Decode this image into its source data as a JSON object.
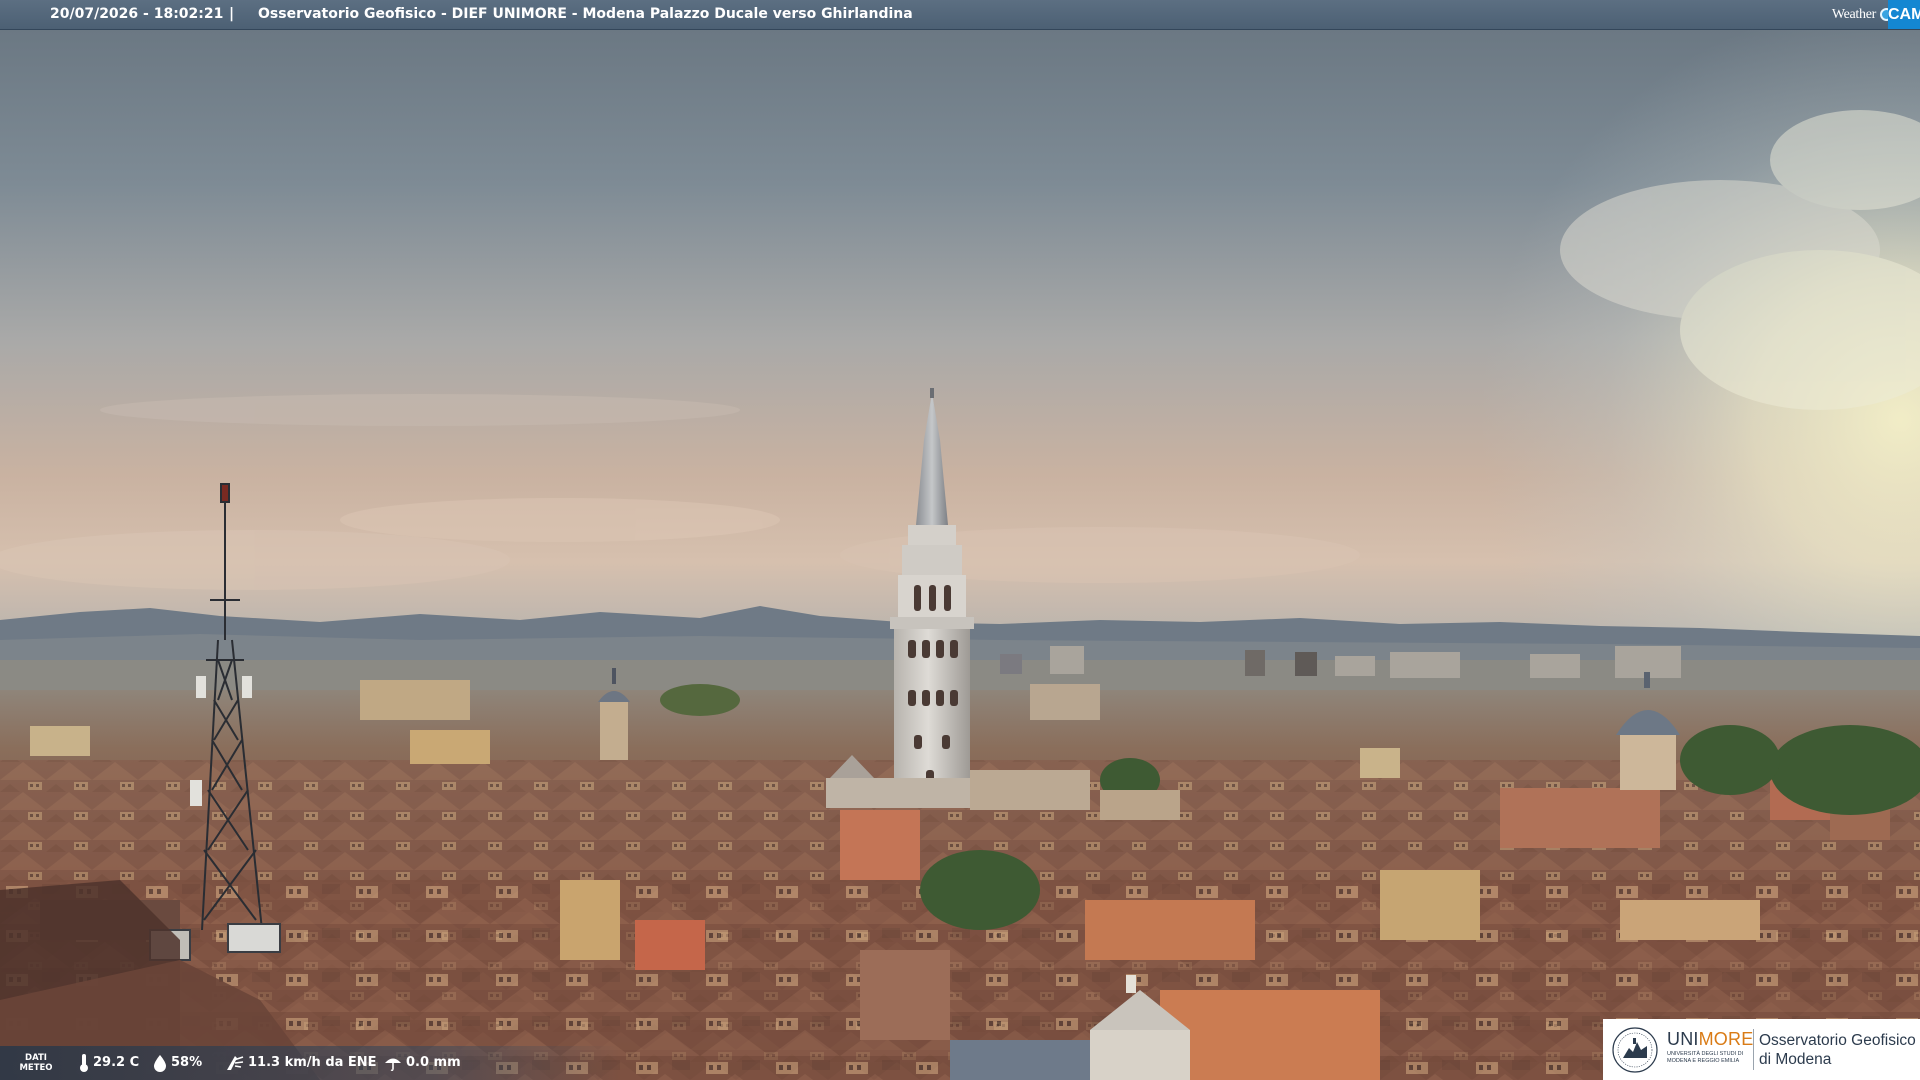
{
  "header": {
    "timestamp": "20/07/2026 - 18:02:21",
    "separator": "|",
    "location": "Osservatorio Geofisico - DIEF UNIMORE - Modena Palazzo Ducale verso Ghirlandina"
  },
  "brand": {
    "weather": "Weather",
    "cam": "CAM"
  },
  "meteo": {
    "label_line1": "DATI",
    "label_line2": "METEO",
    "temperature": "29.2 C",
    "humidity": "58%",
    "wind": "11.3 km/h da ENE",
    "rain": "0.0 mm",
    "icons": [
      "thermometer-icon",
      "droplet-icon",
      "wind-icon",
      "rain-icon"
    ]
  },
  "logo": {
    "university_part1": "UNI",
    "university_part2": "MORE",
    "university_full": "UNIVERSITÀ DEGLI STUDI DI MODENA E REGGIO EMILIA",
    "observatory_line1": "Osservatorio Geofisico",
    "observatory_line2": "di Modena"
  },
  "colors": {
    "topbar": "#4c6074",
    "brand_cam": "#1487d2",
    "unimore_orange": "#d97b16",
    "sky_top": "#6e7b85",
    "roofs": "#8a5a43"
  }
}
